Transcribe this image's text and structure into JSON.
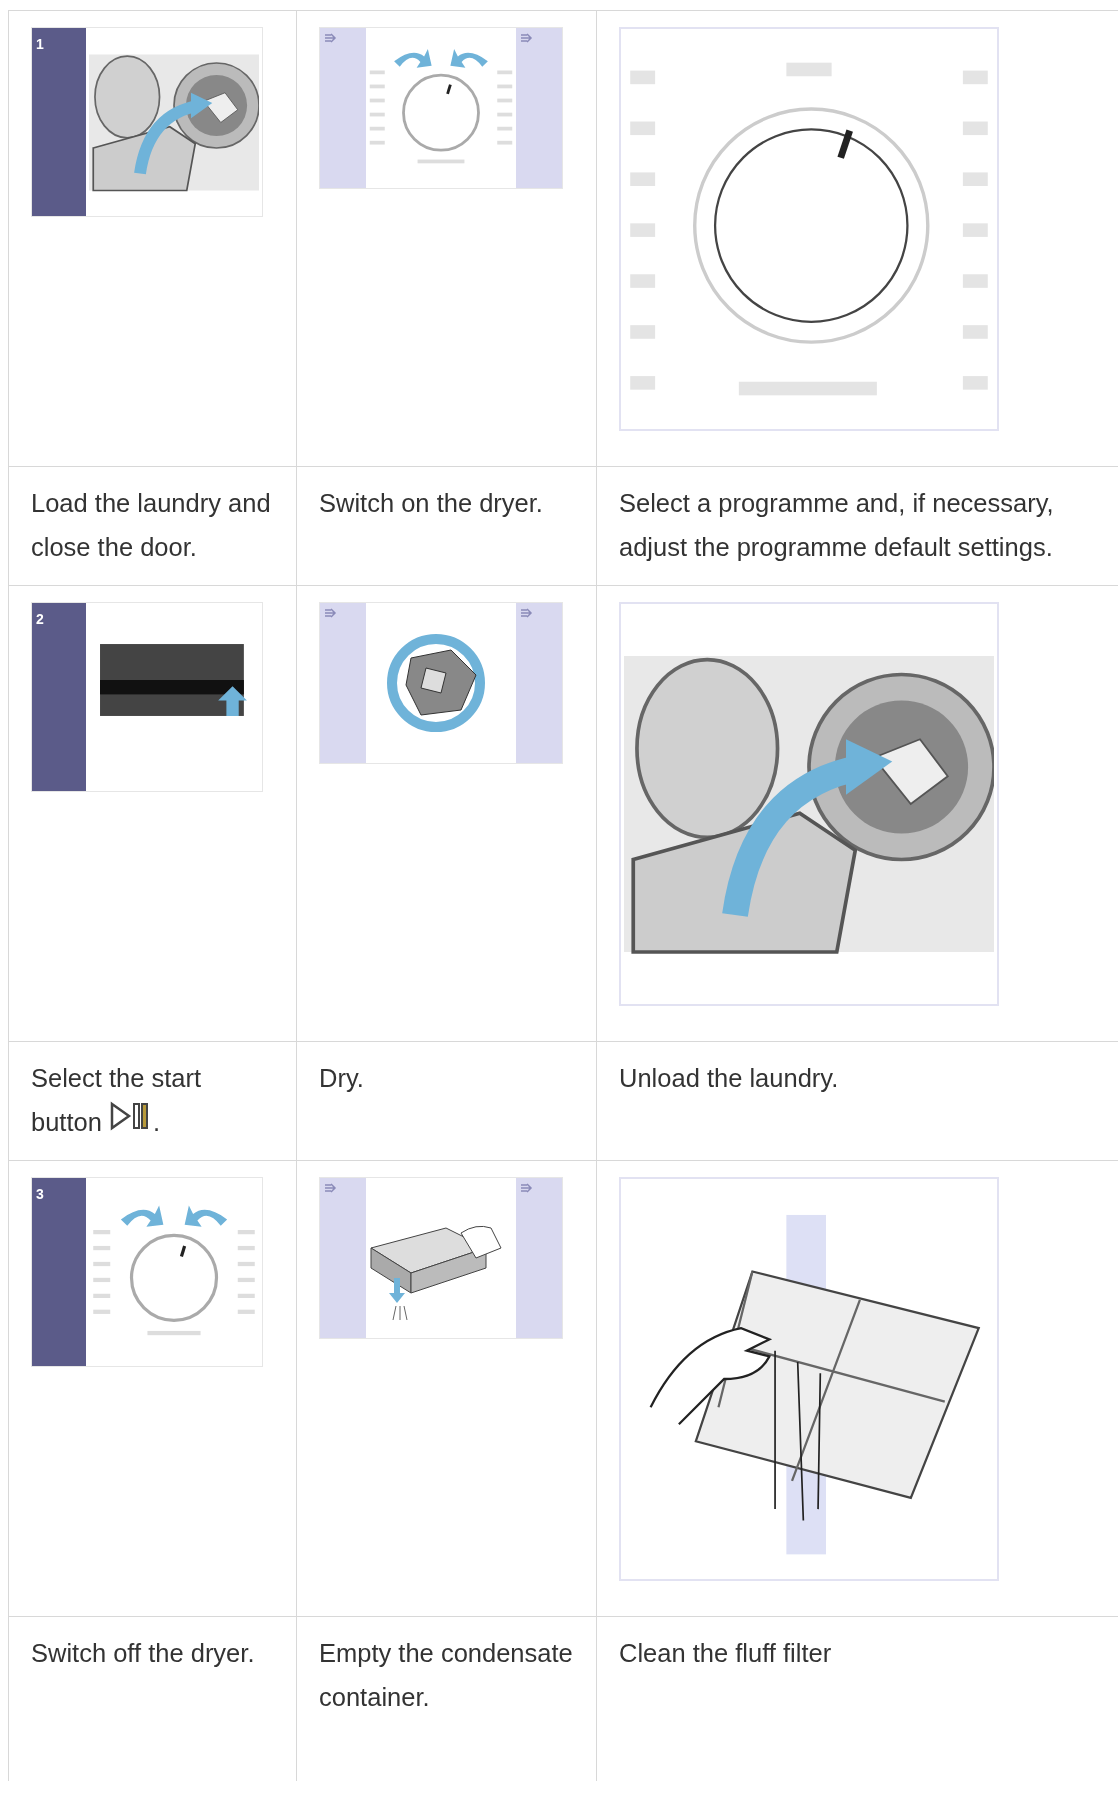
{
  "rows": [
    {
      "cells": [
        {
          "kind": "step",
          "step": "1",
          "picture": {
            "kind": "load"
          }
        },
        {
          "kind": "arrows",
          "picture": {
            "kind": "dial"
          }
        },
        {
          "kind": "plain",
          "picture": {
            "kind": "dial-large"
          }
        }
      ]
    },
    {
      "captions": [
        {
          "text": "Load the laundry and close the door."
        },
        {
          "text": "Switch on the dryer."
        },
        {
          "text": "Select a programme and, if necessary, adjust the programme default settings."
        }
      ]
    },
    {
      "cells": [
        {
          "kind": "step",
          "step": "2",
          "picture": {
            "kind": "panel"
          }
        },
        {
          "kind": "arrows",
          "picture": {
            "kind": "drum"
          }
        },
        {
          "kind": "plain",
          "picture": {
            "kind": "load"
          }
        }
      ]
    },
    {
      "captions": [
        {
          "text": "Select the start button",
          "start_icon": true,
          "after": "."
        },
        {
          "text": "Dry."
        },
        {
          "text": "Unload the laundry."
        }
      ]
    },
    {
      "cells": [
        {
          "kind": "step",
          "step": "3",
          "picture": {
            "kind": "dial"
          }
        },
        {
          "kind": "arrows",
          "picture": {
            "kind": "container"
          }
        },
        {
          "kind": "plain",
          "picture": {
            "kind": "filter"
          }
        }
      ]
    },
    {
      "captions": [
        {
          "text": "Switch off the dryer."
        },
        {
          "text": "Empty the condensate container."
        },
        {
          "text": "Clean the fluff filter"
        }
      ]
    }
  ]
}
